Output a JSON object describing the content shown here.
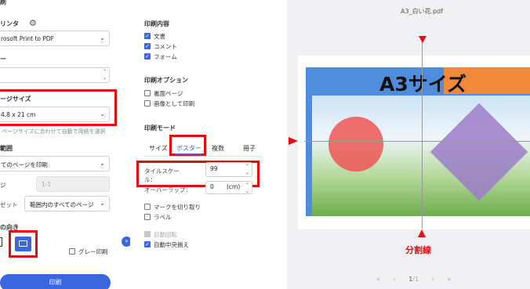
{
  "left": {
    "title_cut": "刷",
    "printer_label": "リンタ",
    "printer_value": "rosoft Print to PDF",
    "copies_label": "ー",
    "pagesize_label": "ージサイズ",
    "pagesize_value": "4.8 x 21 cm",
    "fit_hint": "ページサイズに合わせて自動で用紙を選択",
    "range_label": "範囲",
    "range_value": "てのページを印刷",
    "pages_label": "ジ",
    "pages_placeholder": "1-1",
    "subset_label": "ゼット",
    "subset_value": "範囲内のすべてのページ",
    "orientation_label": "の向き",
    "grayscale_label": "グレー印刷",
    "print_button": "印刷"
  },
  "middle": {
    "content_title": "印刷内容",
    "content_items": [
      "文書",
      "コメント",
      "フォーム"
    ],
    "options_title": "印刷オプション",
    "option_items": [
      "裏面ページ",
      "画像として印刷"
    ],
    "mode_title": "印刷モード",
    "tabs": [
      "サイズ",
      "ポスター",
      "複数",
      "冊子"
    ],
    "tile_scale_label_1": "タイルスケー",
    "tile_scale_label_2": "ル：",
    "tile_scale_value": "99",
    "overlap_label": "オーバーラップ：",
    "overlap_value": "0",
    "overlap_unit": "(cm)",
    "cut_marks": "マークを切り取り",
    "labels": "ラベル",
    "auto_rotate": "自動回転",
    "auto_center": "自動中央揃え"
  },
  "preview": {
    "filename": "A3_白い花.pdf",
    "banner_text": "A3サイズ",
    "split_label": "分割線",
    "page_indicator": "1",
    "page_total": "/1"
  },
  "colors": {
    "accent": "#3a66e0",
    "highlight_red": "#e20d0d",
    "banner_orange": "#f08a3a",
    "banner_blue": "#4f8cdb",
    "circle_red": "#ee5555",
    "diamond_purple": "#9b7cc8"
  }
}
